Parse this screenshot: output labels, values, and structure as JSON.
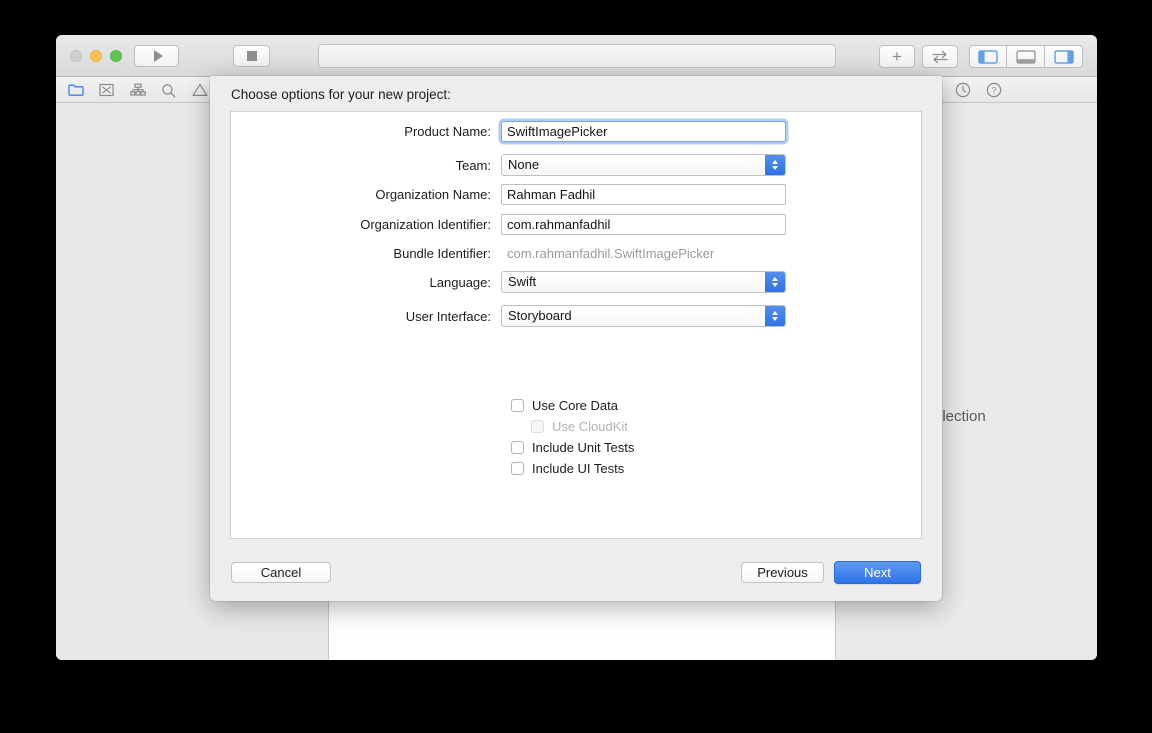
{
  "window": {
    "traffic_lights": [
      "close",
      "minimize",
      "maximize"
    ],
    "toolbar": {
      "run_label": "",
      "stop_label": "",
      "status_text": "",
      "add_label": "+",
      "swap_label": "⇄",
      "panel_toggles": [
        "left-panel",
        "bottom-panel",
        "right-panel"
      ]
    },
    "navigator_icons": [
      "folder-icon",
      "source-control-icon",
      "hierarchy-icon",
      "search-icon",
      "warning-icon"
    ],
    "inspector_icons": [
      "history-icon",
      "help-icon"
    ],
    "editor": {
      "selection_label": "Selection"
    }
  },
  "sheet": {
    "title": "Choose options for your new project:",
    "fields": [
      {
        "label": "Product Name:",
        "value": "SwiftImagePicker",
        "type": "text",
        "focused": true
      },
      {
        "label": "Team:",
        "value": "None",
        "type": "select"
      },
      {
        "label": "Organization Name:",
        "value": "Rahman Fadhil",
        "type": "text",
        "focused": false
      },
      {
        "label": "Organization Identifier:",
        "value": "com.rahmanfadhil",
        "type": "text",
        "focused": false
      },
      {
        "label": "Bundle Identifier:",
        "value": "com.rahmanfadhil.SwiftImagePicker",
        "type": "static"
      },
      {
        "label": "Language:",
        "value": "Swift",
        "type": "select"
      },
      {
        "label": "User Interface:",
        "value": "Storyboard",
        "type": "select"
      }
    ],
    "checkboxes": [
      {
        "label": "Use Core Data",
        "checked": false,
        "disabled": false,
        "indent": false
      },
      {
        "label": "Use CloudKit",
        "checked": false,
        "disabled": true,
        "indent": true
      },
      {
        "label": "Include Unit Tests",
        "checked": false,
        "disabled": false,
        "indent": false
      },
      {
        "label": "Include UI Tests",
        "checked": false,
        "disabled": false,
        "indent": false
      }
    ],
    "buttons": {
      "cancel": "Cancel",
      "previous": "Previous",
      "next": "Next"
    }
  },
  "colors": {
    "accent_blue": "#2f74e8",
    "stepper_blue": "#3d7ce8",
    "focus_ring": "#6ea3e9",
    "window_chrome": "#ececec",
    "sheet_bg": "#ededed"
  }
}
